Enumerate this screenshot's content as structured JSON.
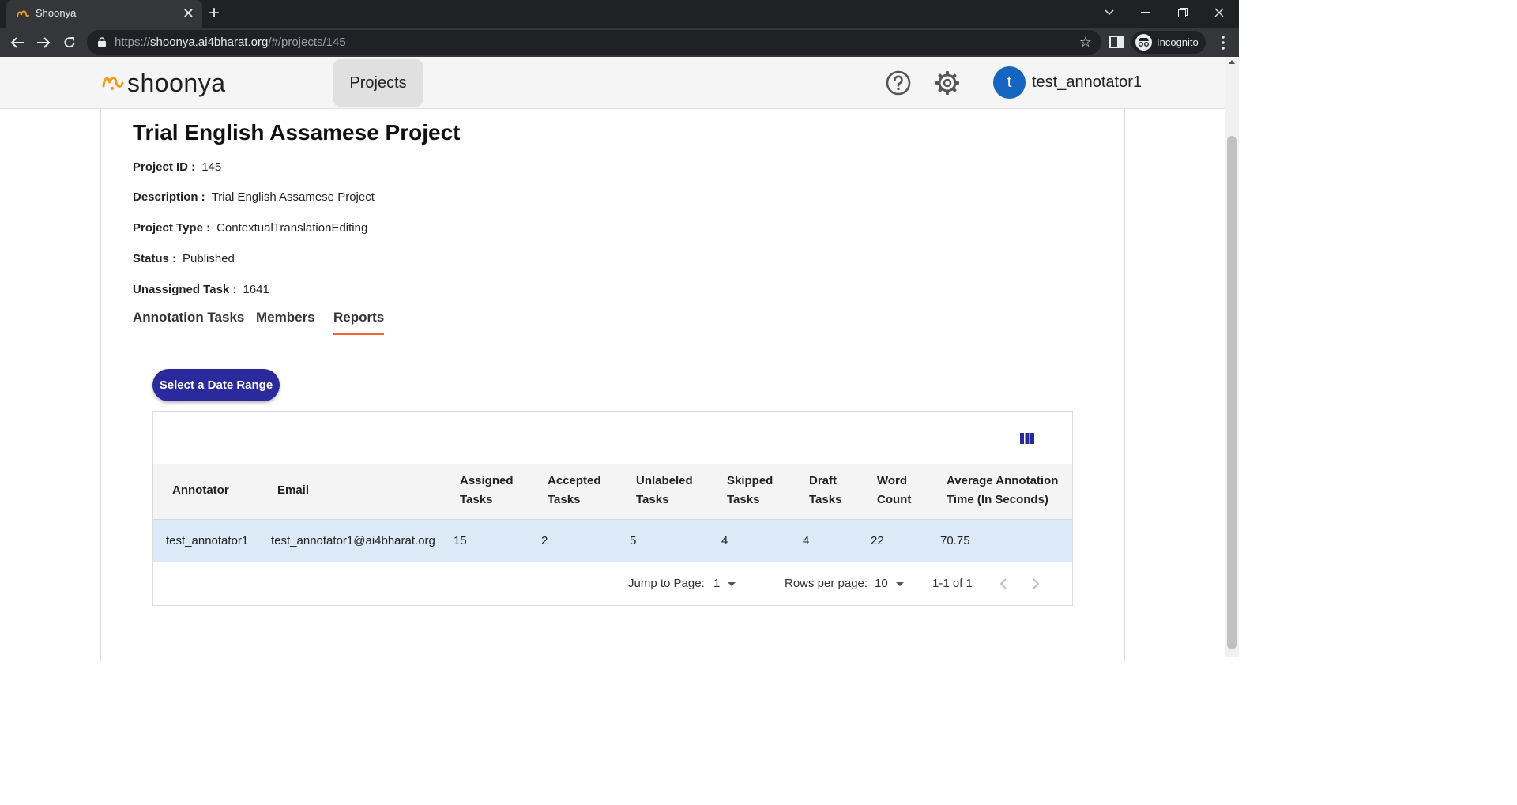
{
  "browser": {
    "tab_title": "Shoonya",
    "url_prefix": "https://",
    "url_host": "shoonya.ai4bharat.org",
    "url_path": "/#/projects/145",
    "incognito_label": "Incognito"
  },
  "header": {
    "logo_text": "shoonya",
    "projects_label": "Projects",
    "avatar_initial": "t",
    "username": "test_annotator1",
    "accent_color": "#f39c12"
  },
  "project": {
    "title": "Trial English Assamese Project",
    "fields": [
      {
        "label": "Project ID :",
        "value": "145"
      },
      {
        "label": "Description :",
        "value": "Trial English Assamese Project"
      },
      {
        "label": "Project Type :",
        "value": "ContextualTranslationEditing"
      },
      {
        "label": "Status :",
        "value": "Published"
      },
      {
        "label": "Unassigned Task :",
        "value": "1641"
      }
    ],
    "tabs": [
      "Annotation Tasks",
      "Members",
      "Reports"
    ],
    "active_tab": "Reports"
  },
  "reports": {
    "date_range_label": "Select a Date Range",
    "columns": [
      {
        "line1": "Annotator",
        "line2": ""
      },
      {
        "line1": "Email",
        "line2": ""
      },
      {
        "line1": "Assigned",
        "line2": "Tasks"
      },
      {
        "line1": "Accepted",
        "line2": "Tasks"
      },
      {
        "line1": "Unlabeled",
        "line2": "Tasks"
      },
      {
        "line1": "Skipped",
        "line2": "Tasks"
      },
      {
        "line1": "Draft",
        "line2": "Tasks"
      },
      {
        "line1": "Word",
        "line2": "Count"
      },
      {
        "line1": "Average Annotation",
        "line2": "Time (In Seconds)"
      }
    ],
    "rows": [
      [
        "test_annotator1",
        "test_annotator1@ai4bharat.org",
        "15",
        "2",
        "5",
        "4",
        "4",
        "22",
        "70.75"
      ]
    ],
    "pagination": {
      "jump_label": "Jump to Page:",
      "jump_value": "1",
      "rows_label": "Rows per page:",
      "rows_value": "10",
      "range_text": "1-1 of 1"
    }
  }
}
